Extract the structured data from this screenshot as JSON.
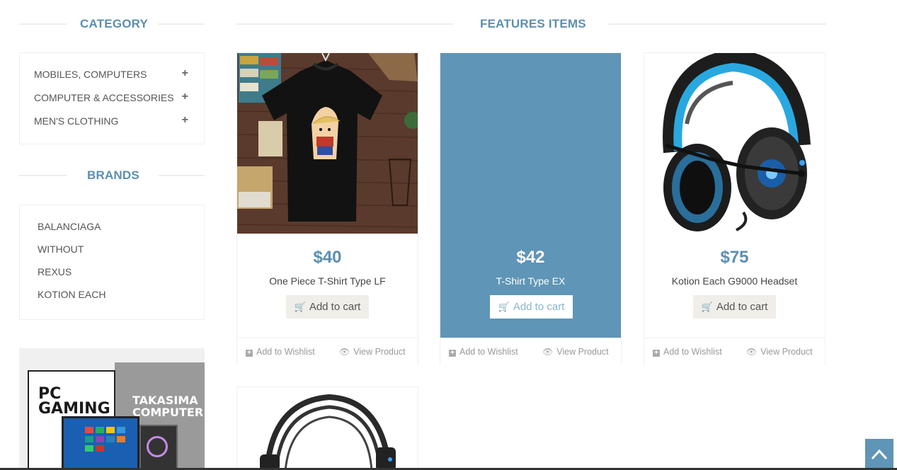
{
  "sidebar": {
    "category_title": "CATEGORY",
    "categories": [
      {
        "label": "MOBILES, COMPUTERS",
        "expand": "+"
      },
      {
        "label": "COMPUTER & ACCESSORIES",
        "expand": "+"
      },
      {
        "label": "MEN'S CLOTHING",
        "expand": "+"
      }
    ],
    "brands_title": "BRANDS",
    "brands": [
      "BALANCIAGA",
      "WITHOUT",
      "REXUS",
      "KOTION EACH"
    ],
    "ad": {
      "left_text": "PC\nGAMING",
      "right_text": "TAKASIMA\nCOMPUTER"
    }
  },
  "main": {
    "title": "FEATURES ITEMS",
    "products": [
      {
        "price": "$40",
        "name": "One Piece T-Shirt Type LF",
        "cart": "Add to cart",
        "wishlist": "Add to Wishlist",
        "view": "View Product",
        "image": "black-tshirt"
      },
      {
        "price": "$42",
        "name": "T-Shirt Type EX",
        "cart": "Add to cart",
        "wishlist": "Add to Wishlist",
        "view": "View Product",
        "image": "none"
      },
      {
        "price": "$75",
        "name": "Kotion Each G9000 Headset",
        "cart": "Add to cart",
        "wishlist": "Add to Wishlist",
        "view": "View Product",
        "image": "blue-headset"
      },
      {
        "price": "",
        "name": "",
        "cart": "",
        "wishlist": "",
        "view": "",
        "image": "black-headset"
      }
    ]
  },
  "colors": {
    "accent": "#5f95b6",
    "title": "#5b8fb0",
    "cart_bg": "#f0eee9"
  },
  "icons": {
    "expand": "plus-icon",
    "cart": "shopping-cart-icon",
    "wishlist": "plus-square-icon",
    "view": "eye-icon",
    "scroll_top": "chevron-up-icon"
  }
}
